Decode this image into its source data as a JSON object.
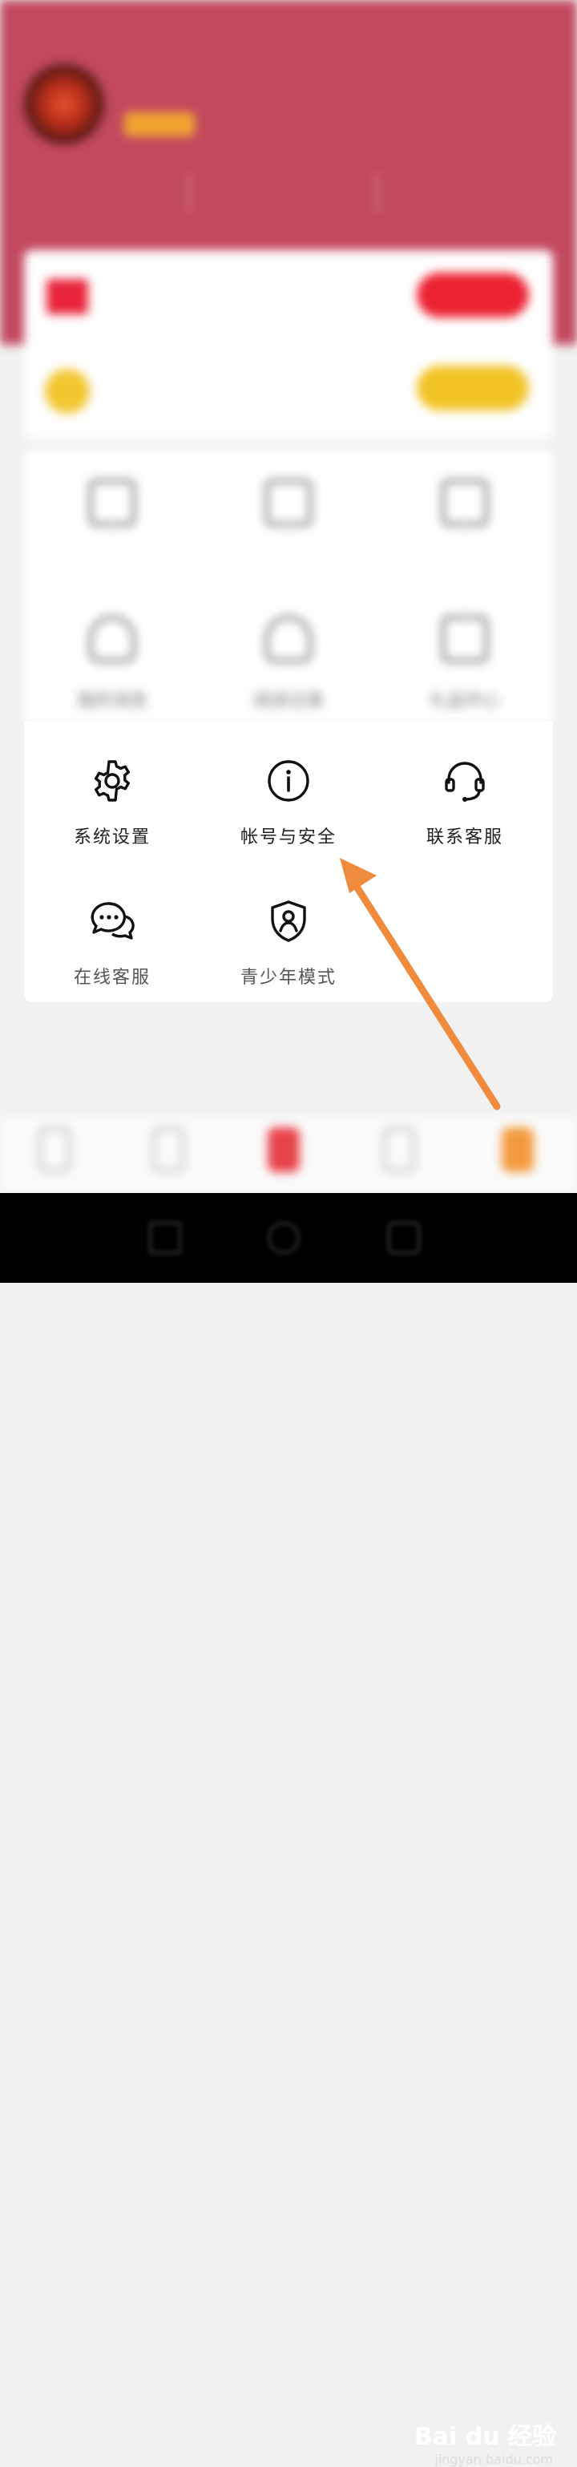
{
  "status_bar": {
    "left": "",
    "right": ""
  },
  "profile": {
    "name": "",
    "badge": "",
    "link_label": ""
  },
  "stats": [
    {
      "value": "",
      "label": ""
    },
    {
      "value": "",
      "label": ""
    },
    {
      "value": "",
      "label": ""
    }
  ],
  "promos": [
    {
      "title": "",
      "subtitle": "",
      "button": "",
      "color": "#ec2233"
    },
    {
      "title": "",
      "subtitle": "",
      "button": "",
      "color": "#f2c327"
    }
  ],
  "blurred_grid": [
    {
      "label": "",
      "icon": "document-icon"
    },
    {
      "label": "",
      "icon": "bookshelf-icon"
    },
    {
      "label": "",
      "icon": "shield-icon"
    },
    {
      "label": "我的消息",
      "icon": "bell-icon"
    },
    {
      "label": "阅读记录",
      "icon": "cloud-icon"
    },
    {
      "label": "礼品中心",
      "icon": "gift-icon"
    }
  ],
  "menu": [
    {
      "label": "系统设置",
      "icon": "gear-icon"
    },
    {
      "label": "帐号与安全",
      "icon": "info-icon"
    },
    {
      "label": "联系客服",
      "icon": "headset-icon"
    },
    {
      "label": "在线客服",
      "icon": "chat-bubbles-icon"
    },
    {
      "label": "青少年模式",
      "icon": "teen-shield-icon"
    }
  ],
  "watermark": {
    "brand": "Bai du 经验",
    "url": "jingyan.baidu.com"
  },
  "colors": {
    "header": "#c2495e",
    "annotation_arrow": "#f08a3c",
    "accent_tab": "#f39a3d"
  }
}
